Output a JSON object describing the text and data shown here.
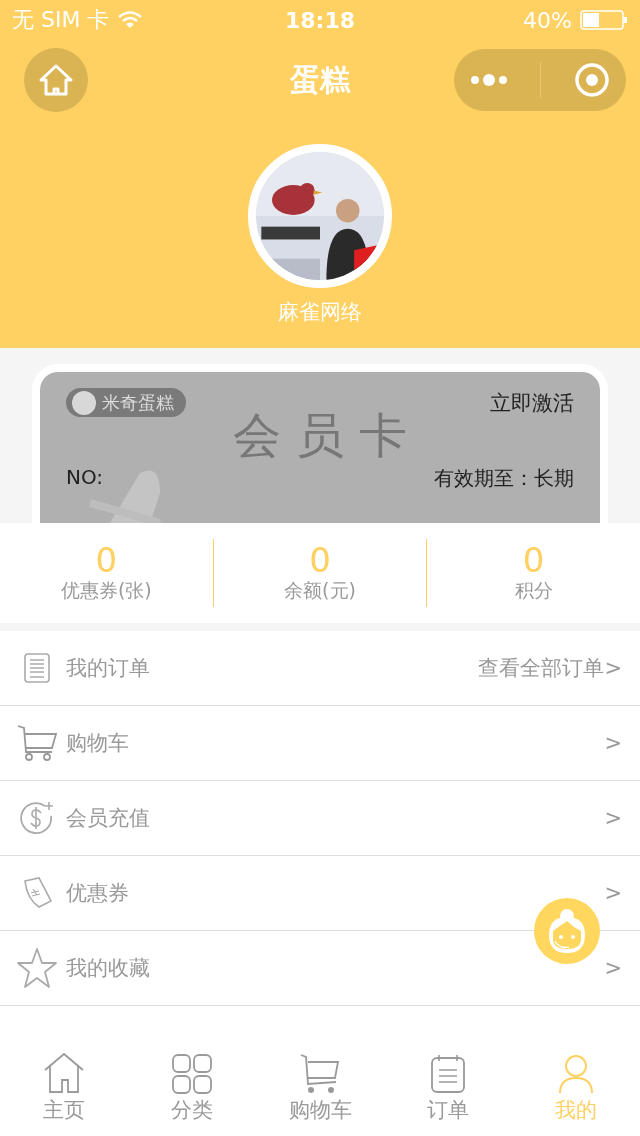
{
  "status_bar": {
    "carrier": "无 SIM 卡",
    "time": "18:18",
    "battery": "40%"
  },
  "nav": {
    "title": "蛋糕"
  },
  "profile": {
    "name": "麻雀网络"
  },
  "card": {
    "brand": "米奇蛋糕",
    "action": "立即激活",
    "title": "会 员 卡",
    "number_label": "NO:",
    "validity": "有效期至：长期"
  },
  "stats": [
    {
      "value": "0",
      "label": "优惠券(张)"
    },
    {
      "value": "0",
      "label": "余额(元)"
    },
    {
      "value": "0",
      "label": "积分"
    }
  ],
  "menu": [
    {
      "kind": "orders",
      "label": "我的订单",
      "extra": "查看全部订单>"
    },
    {
      "kind": "cart",
      "label": "购物车",
      "extra": ">"
    },
    {
      "kind": "recharge",
      "label": "会员充值",
      "extra": ">"
    },
    {
      "kind": "coupon",
      "label": "优惠券",
      "extra": ">"
    },
    {
      "kind": "favorite",
      "label": "我的收藏",
      "extra": ">"
    }
  ],
  "tabs": [
    {
      "kind": "home",
      "label": "主页",
      "selected": false
    },
    {
      "kind": "category",
      "label": "分类",
      "selected": false
    },
    {
      "kind": "cart",
      "label": "购物车",
      "selected": false
    },
    {
      "kind": "orders",
      "label": "订单",
      "selected": false
    },
    {
      "kind": "me",
      "label": "我的",
      "selected": true
    }
  ]
}
